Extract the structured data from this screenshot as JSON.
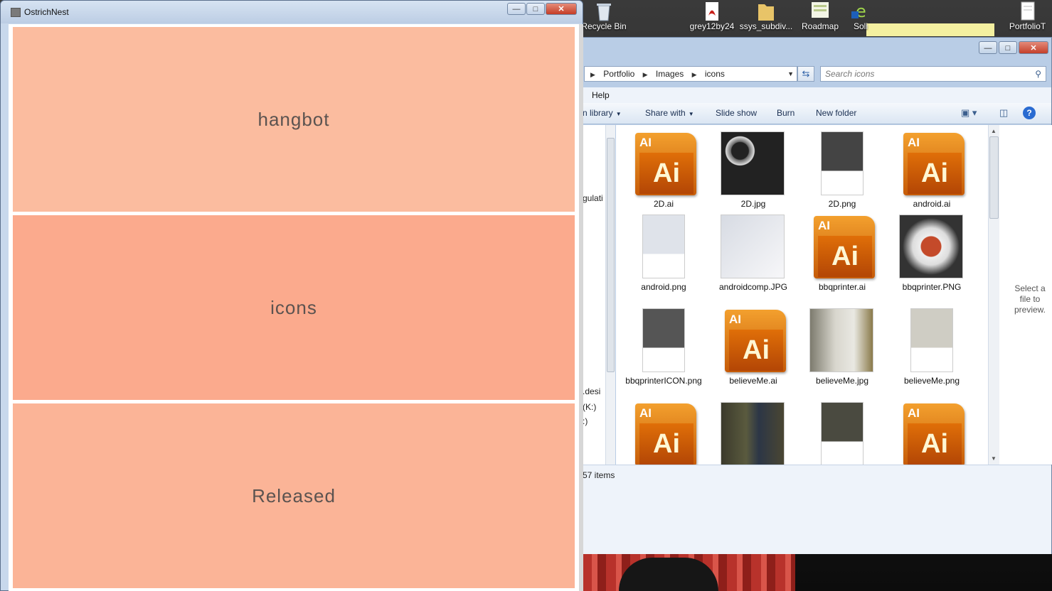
{
  "desktop": {
    "icons": [
      {
        "label": "Recycle Bin",
        "icon": "recycle-bin-icon"
      },
      {
        "label": "grey12by24",
        "icon": "pdf-file-icon"
      },
      {
        "label": "ssys_subdiv...",
        "icon": "folder-icon"
      },
      {
        "label": "Roadmap",
        "icon": "document-icon"
      },
      {
        "label": "Soli",
        "icon": "shortcut-icon"
      },
      {
        "label": "PortfolioT",
        "icon": "text-file-icon"
      }
    ]
  },
  "explorer": {
    "window_buttons": {
      "minimize": "—",
      "maximize": "□",
      "close": "✕"
    },
    "breadcrumb": [
      "Portfolio",
      "Images",
      "icons"
    ],
    "search_placeholder": "Search icons",
    "menu": [
      "Help"
    ],
    "toolbar": {
      "include_in_library": "n library",
      "share_with": "Share with",
      "slide_show": "Slide show",
      "burn": "Burn",
      "new_folder": "New folder"
    },
    "nav_fragments": [
      "gulati",
      ".desi",
      "(K:)",
      ":)"
    ],
    "files": [
      {
        "name": "2D.ai",
        "kind": "ai"
      },
      {
        "name": "2D.jpg",
        "kind": "photo-records"
      },
      {
        "name": "2D.png",
        "kind": "photo-portrait"
      },
      {
        "name": "android.ai",
        "kind": "ai"
      },
      {
        "name": "android.png",
        "kind": "photo-portrait"
      },
      {
        "name": "androidcomp.JPG",
        "kind": "photo-tablet"
      },
      {
        "name": "bbqprinter.ai",
        "kind": "ai"
      },
      {
        "name": "bbqprinter.PNG",
        "kind": "photo-printer"
      },
      {
        "name": "bbqprinterICON.png",
        "kind": "photo-portrait"
      },
      {
        "name": "believeMe.ai",
        "kind": "ai"
      },
      {
        "name": "believeMe.jpg",
        "kind": "photo-wall"
      },
      {
        "name": "believeMe.png",
        "kind": "photo-portrait"
      },
      {
        "name": "",
        "kind": "ai"
      },
      {
        "name": "",
        "kind": "photo-dark"
      },
      {
        "name": "",
        "kind": "photo-portrait"
      },
      {
        "name": "",
        "kind": "ai"
      }
    ],
    "preview_text": "Select a file to preview.",
    "item_count": "57 items",
    "ai_label": "Ai",
    "ai_small_label": "AI"
  },
  "ostrichnest": {
    "title": "OstrichNest",
    "window_buttons": {
      "minimize": "—",
      "maximize": "□",
      "close": "✕"
    },
    "tiles": [
      {
        "label": "hangbot",
        "color": "#fbbc9f"
      },
      {
        "label": "icons",
        "color": "#fbaa8d"
      },
      {
        "label": "Released",
        "color": "#fbb497"
      }
    ]
  }
}
